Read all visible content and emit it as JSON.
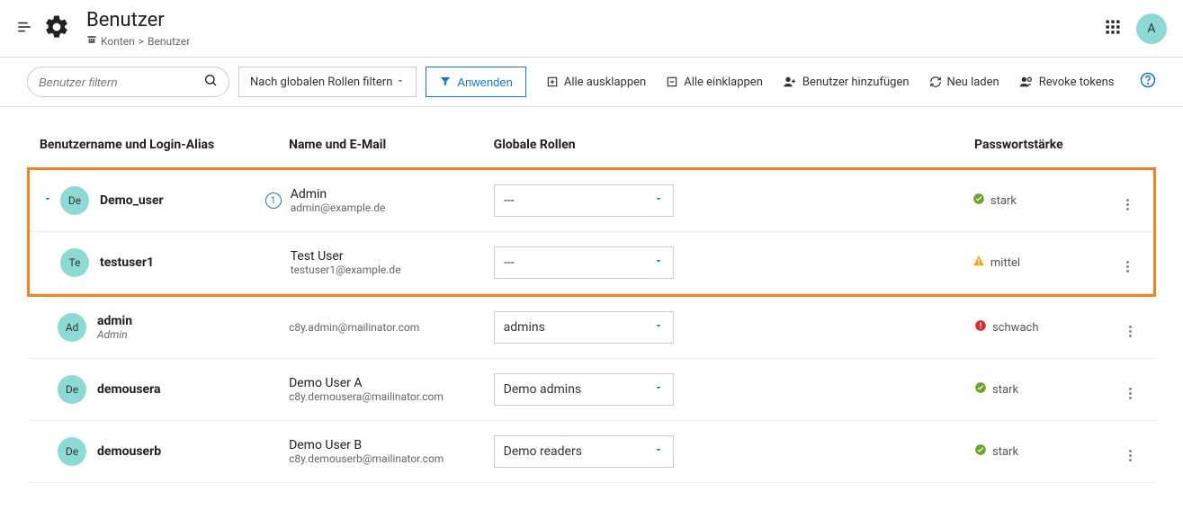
{
  "header": {
    "title": "Benutzer",
    "breadcrumb_root": "Konten",
    "breadcrumb_sep": ">",
    "breadcrumb_current": "Benutzer",
    "avatar_initial": "A"
  },
  "toolbar": {
    "filter_placeholder": "Benutzer filtern",
    "role_filter_label": "Nach globalen Rollen filtern",
    "apply_label": "Anwenden",
    "expand_all": "Alle ausklappen",
    "collapse_all": "Alle einklappen",
    "add_user": "Benutzer hinzufügen",
    "reload": "Neu laden",
    "revoke_tokens": "Revoke tokens"
  },
  "columns": {
    "user": "Benutzername und Login-Alias",
    "name": "Name und E-Mail",
    "roles": "Globale Rollen",
    "pwd": "Passwortstärke"
  },
  "strength": {
    "strong": "stark",
    "medium": "mittel",
    "weak": "schwach"
  },
  "rows": [
    {
      "avatar": "De",
      "username": "Demo_user",
      "alias": "",
      "has_chevron": true,
      "info_badge": "1",
      "name": "Admin",
      "email": "admin@example.de",
      "role": "---",
      "strength": "strong"
    },
    {
      "avatar": "Te",
      "username": "testuser1",
      "alias": "",
      "has_chevron": false,
      "info_badge": "",
      "name": "Test User",
      "email": "testuser1@example.de",
      "role": "---",
      "strength": "medium"
    },
    {
      "avatar": "Ad",
      "username": "admin",
      "alias": "Admin",
      "has_chevron": false,
      "info_badge": "",
      "name": "",
      "email": "c8y.admin@mailinator.com",
      "role": "admins",
      "strength": "weak"
    },
    {
      "avatar": "De",
      "username": "demousera",
      "alias": "",
      "has_chevron": false,
      "info_badge": "",
      "name": "Demo User A",
      "email": "c8y.demousera@mailinator.com",
      "role": "Demo admins",
      "strength": "strong"
    },
    {
      "avatar": "De",
      "username": "demouserb",
      "alias": "",
      "has_chevron": false,
      "info_badge": "",
      "name": "Demo User B",
      "email": "c8y.demouserb@mailinator.com",
      "role": "Demo readers",
      "strength": "strong"
    }
  ]
}
